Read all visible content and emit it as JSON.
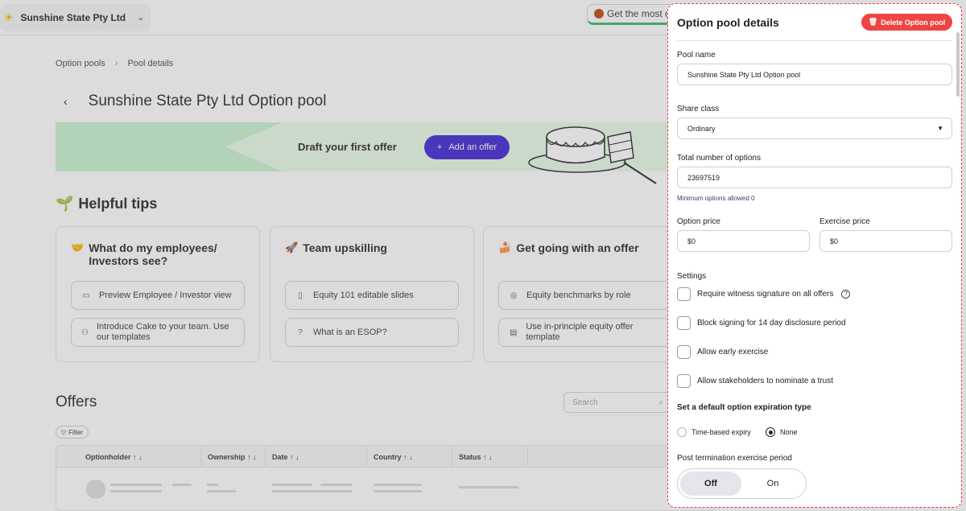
{
  "topbar": {
    "company_name": "Sunshine State Pty Ltd",
    "get_most": "Get the most o"
  },
  "breadcrumb": [
    "Option pools",
    "Pool details"
  ],
  "page_title": "Sunshine State Pty Ltd Option pool",
  "banner": {
    "draft_text": "Draft your first offer",
    "add_offer_label": "Add an offer"
  },
  "tips": {
    "title": "Helpful tips",
    "cards": [
      {
        "heading": "What do my employees/ Investors see?",
        "icon": "handshake-icon",
        "items": [
          {
            "label": "Preview Employee / Investor view",
            "icon": "monitor-icon"
          },
          {
            "label": "Introduce Cake to your team. Use our templates",
            "icon": "users-icon"
          }
        ]
      },
      {
        "heading": "Team upskilling",
        "icon": "rocket-icon",
        "items": [
          {
            "label": "Equity 101 editable slides",
            "icon": "book-icon"
          },
          {
            "label": "What is an ESOP?",
            "icon": "question-icon"
          }
        ]
      },
      {
        "heading": "Get going with an offer",
        "icon": "cake-icon",
        "items": [
          {
            "label": "Equity benchmarks by role",
            "icon": "target-icon"
          },
          {
            "label": "Use in-principle equity offer template",
            "icon": "document-icon"
          }
        ]
      }
    ]
  },
  "offers": {
    "title": "Offers",
    "search_placeholder": "Search",
    "filter_label": "Filter",
    "columns": [
      "Optionholder",
      "Ownership",
      "Date",
      "Country",
      "Status"
    ]
  },
  "panel": {
    "title": "Option pool details",
    "delete_label": "Delete Option pool",
    "pool_name_label": "Pool name",
    "pool_name_value": "Sunshine State Pty Ltd Option pool",
    "share_class_label": "Share class",
    "share_class_value": "Ordinary",
    "total_options_label": "Total number of options",
    "total_options_value": "23697519",
    "min_options_hint": "Minimum options allowed 0",
    "option_price_label": "Option price",
    "option_price_value": "$0",
    "exercise_price_label": "Exercise price",
    "exercise_price_value": "$0",
    "settings_label": "Settings",
    "settings": [
      "Require witness signature on all offers",
      "Block signing for 14 day disclosure period",
      "Allow early exercise",
      "Allow stakeholders to nominate a trust"
    ],
    "expiration_label": "Set a default option expiration type",
    "expiration_options": [
      "Time-based expiry",
      "None"
    ],
    "expiration_selected": "None",
    "post_termination_label": "Post termination exercise period",
    "toggle_off": "Off",
    "toggle_on": "On",
    "toggle_selected": "Off"
  },
  "colors": {
    "accent": "#3b1fd1",
    "danger": "#ef4444",
    "banner_green": "#c8f3cf"
  }
}
